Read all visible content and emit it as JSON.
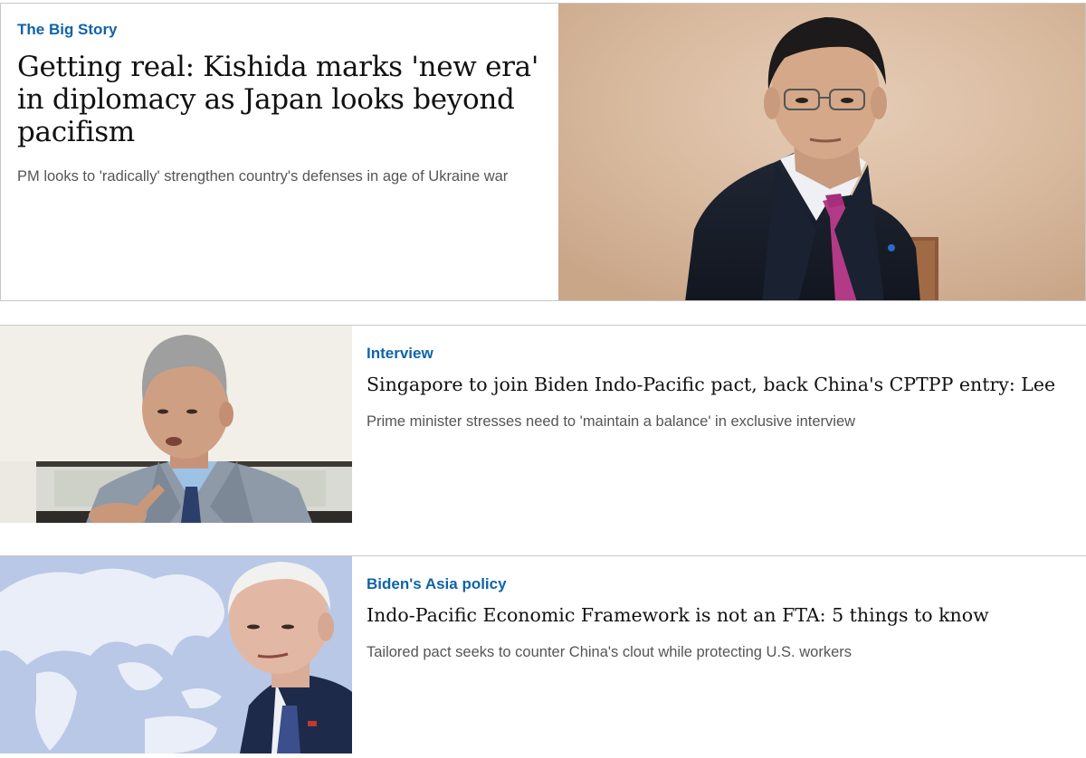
{
  "big_story": {
    "kicker": "The Big Story",
    "headline": "Getting real: Kishida marks 'new era' in diplomacy as Japan looks beyond pacifism",
    "standfirst": "PM looks to 'radically' strengthen country's defenses in age of Ukraine war",
    "photo_icon": "portrait-photo"
  },
  "stories": [
    {
      "kicker": "Interview",
      "headline": "Singapore to join Biden Indo-Pacific pact, back China's CPTPP entry: Lee",
      "standfirst": "Prime minister stresses need to 'maintain a balance' in exclusive interview",
      "photo_icon": "portrait-photo"
    },
    {
      "kicker": "Biden's Asia policy",
      "headline": "Indo-Pacific Economic Framework is not an FTA: 5 things to know",
      "standfirst": "Tailored pact seeks to counter China's clout while protecting U.S. workers",
      "photo_icon": "map-portrait-photo"
    }
  ],
  "colors": {
    "kicker": "#0f63a8",
    "headline": "#111111",
    "standfirst": "#555555",
    "border": "#c8c8c8"
  }
}
